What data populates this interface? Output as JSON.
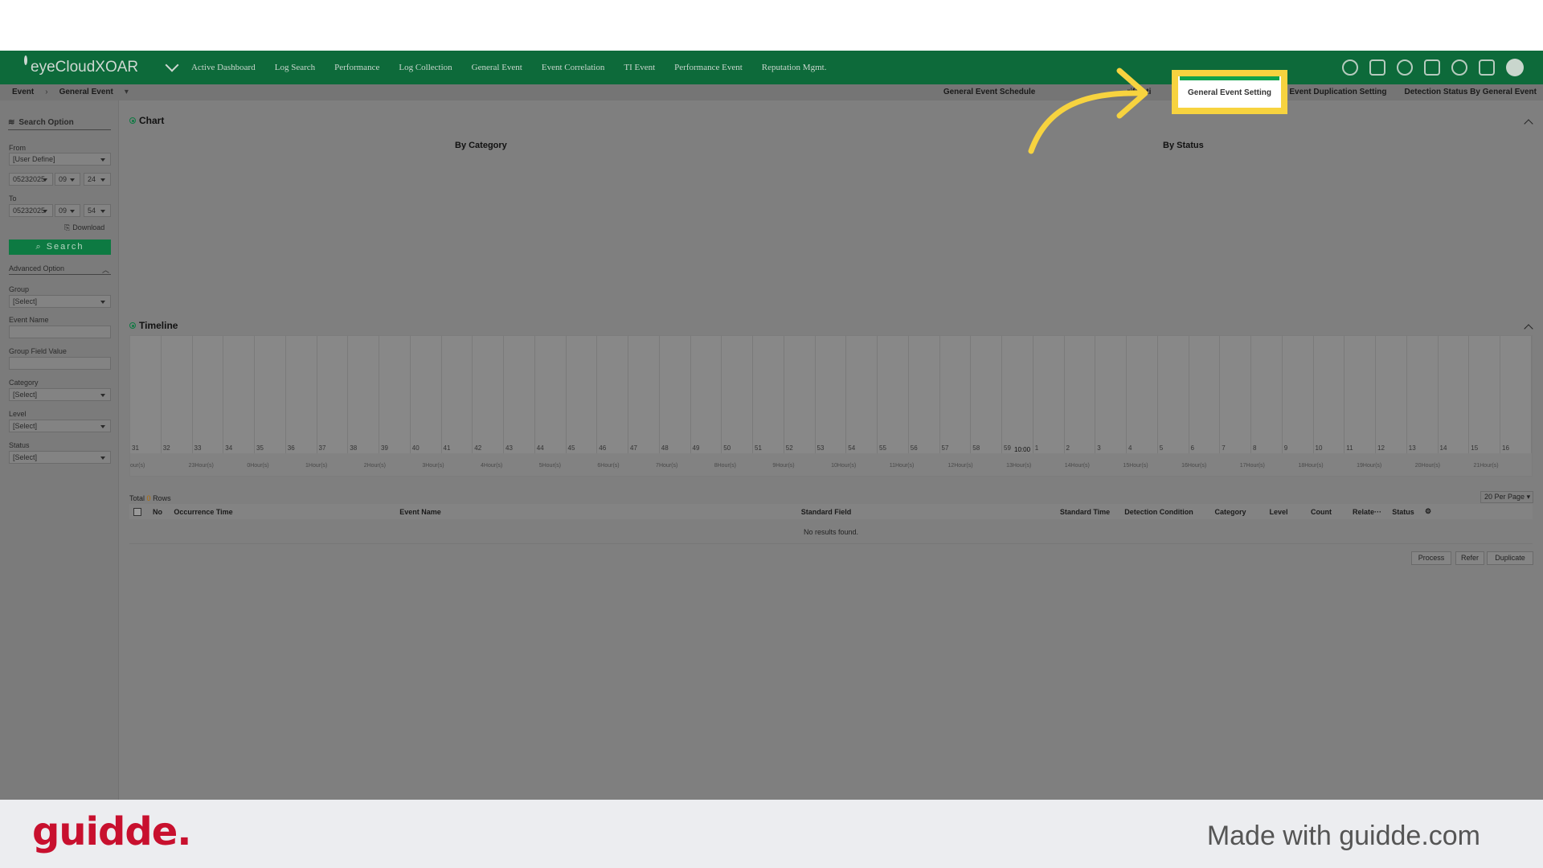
{
  "app": {
    "name": "eyeCloudXOAR"
  },
  "nav": [
    "Active Dashboard",
    "Log Search",
    "Performance",
    "Log Collection",
    "General Event",
    "Event Correlation",
    "TI Event",
    "Performance Event",
    "Reputation Mgmt."
  ],
  "breadcrumb": {
    "root": "Event",
    "current": "General Event"
  },
  "tabs": [
    "General Event Schedule",
    "rificati",
    "General Event Duplication Setting",
    "Detection Status By General Event"
  ],
  "highlighted_tab": "General Event Setting",
  "sidebar": {
    "title": "Search Option",
    "from_label": "From",
    "range_value": "[User Define]",
    "from_date": "05232025",
    "from_hour": "09",
    "from_min": "24",
    "to_label": "To",
    "to_date": "05232025",
    "to_hour": "09",
    "to_min": "54",
    "download": "Download",
    "search": "Search",
    "advanced": "Advanced Option",
    "group_label": "Group",
    "group_value": "[Select]",
    "event_name_label": "Event Name",
    "group_field_label": "Group Field Value",
    "category_label": "Category",
    "category_value": "[Select]",
    "level_label": "Level",
    "level_value": "[Select]",
    "status_label": "Status",
    "status_value": "[Select]"
  },
  "chart_section": {
    "title": "Chart",
    "by_category": "By Category",
    "by_status": "By Status"
  },
  "timeline": {
    "title": "Timeline",
    "ticks": [
      "31",
      "32",
      "33",
      "34",
      "35",
      "36",
      "37",
      "38",
      "39",
      "40",
      "41",
      "42",
      "43",
      "44",
      "45",
      "46",
      "47",
      "48",
      "49",
      "50",
      "51",
      "52",
      "53",
      "54",
      "55",
      "56",
      "57",
      "58",
      "59",
      "1",
      "2",
      "3",
      "4",
      "5",
      "6",
      "7",
      "8",
      "9",
      "10",
      "11",
      "12",
      "13",
      "14",
      "15",
      "16"
    ],
    "marker": "10:00",
    "hours": [
      "our(s)",
      "23Hour(s)",
      "0Hour(s)",
      "1Hour(s)",
      "2Hour(s)",
      "3Hour(s)",
      "4Hour(s)",
      "5Hour(s)",
      "6Hour(s)",
      "7Hour(s)",
      "8Hour(s)",
      "9Hour(s)",
      "10Hour(s)",
      "11Hour(s)",
      "12Hour(s)",
      "13Hour(s)",
      "14Hour(s)",
      "15Hour(s)",
      "16Hour(s)",
      "17Hour(s)",
      "18Hour(s)",
      "19Hour(s)",
      "20Hour(s)",
      "21Hour(s)"
    ]
  },
  "table": {
    "total_prefix": "Total",
    "total_count": "0",
    "total_suffix": "Rows",
    "per_page": "20 Per Page",
    "columns": [
      "No",
      "Occurrence Time",
      "Event Name",
      "Standard Field",
      "Standard Time",
      "Detection Condition",
      "Category",
      "Level",
      "Count",
      "Relate···",
      "Status"
    ],
    "empty": "No results found."
  },
  "actions": {
    "process": "Process",
    "refer": "Refer",
    "duplicate": "Duplicate"
  },
  "footer": {
    "brand": "guidde.",
    "made_with": "Made with guidde.com"
  },
  "colors": {
    "header": "#0d6a3a",
    "highlight": "#f7d33f",
    "brand": "#c8102e"
  }
}
